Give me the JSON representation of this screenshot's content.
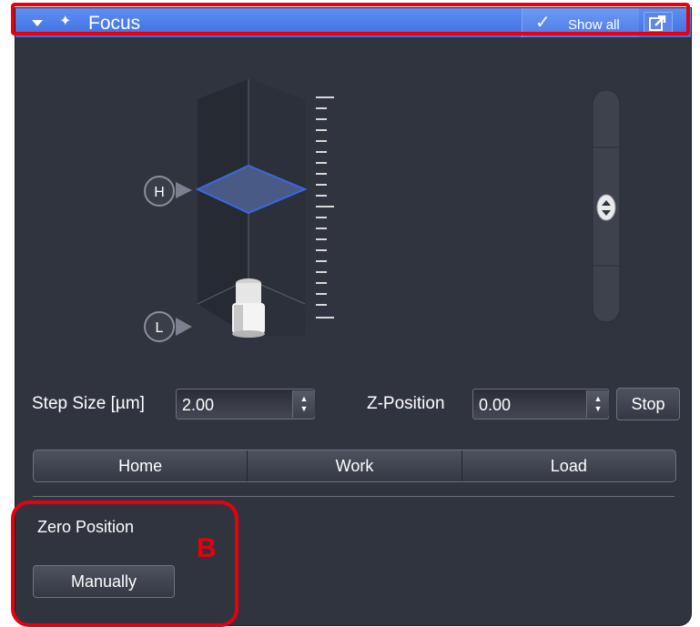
{
  "panel": {
    "title": "Focus",
    "show_all_label": "Show all",
    "icons": {
      "collapse": "chevron-down-icon",
      "title": "sparkle-plus-icon",
      "check": "checkmark-icon",
      "undock": "undock-arrow-icon"
    }
  },
  "focus_control": {
    "high_label": "H",
    "low_label": "L"
  },
  "step_size": {
    "label": "Step Size [µm]",
    "value": "2.00"
  },
  "z_position": {
    "label": "Z-Position",
    "value": "0.00"
  },
  "stop_label": "Stop",
  "position_buttons": [
    "Home",
    "Work",
    "Load"
  ],
  "zero_position": {
    "label": "Zero Position",
    "button_label": "Manually"
  },
  "annotation": {
    "label": "B",
    "color": "#e8000c"
  },
  "colors": {
    "panel_bg": "#30343f",
    "titlebar": "#3d6fe0",
    "focus_plane": "#3a68e0"
  }
}
